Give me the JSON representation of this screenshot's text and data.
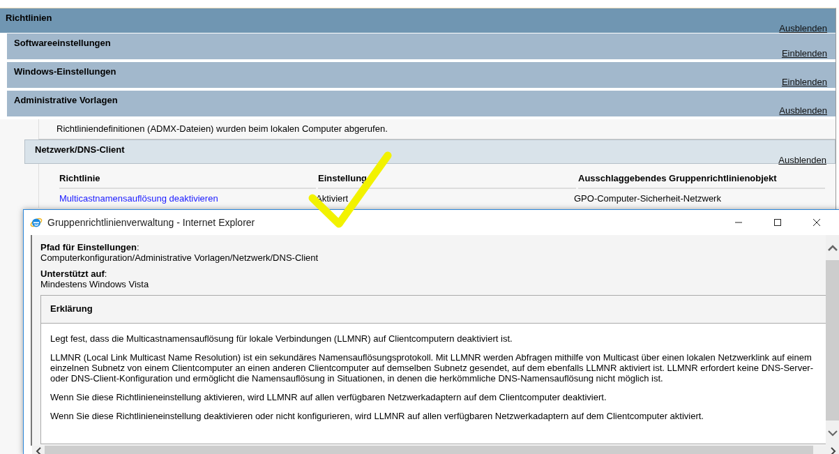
{
  "report": {
    "title": "Richtlinien",
    "toggle": "Ausblenden",
    "children": [
      {
        "title": "Softwareeinstellungen",
        "toggle": "Einblenden"
      },
      {
        "title": "Windows-Einstellungen",
        "toggle": "Einblenden"
      },
      {
        "title": "Administrative Vorlagen",
        "toggle": "Ausblenden",
        "note": "Richtliniendefinitionen (ADMX-Dateien) wurden beim lokalen Computer abgerufen.",
        "children": [
          {
            "title": "Netzwerk/DNS-Client",
            "toggle": "Ausblenden",
            "table": {
              "columns": [
                "Richtlinie",
                "Einstellung",
                "Ausschlaggebendes Gruppenrichtlinienobjekt"
              ],
              "rows": [
                {
                  "cells": [
                    "Multicastnamensauflösung deaktivieren",
                    "Aktiviert",
                    "GPO-Computer-Sicherheit-Netzwerk"
                  ]
                }
              ]
            }
          }
        ]
      }
    ]
  },
  "popup": {
    "title": "Gruppenrichtlinienverwaltung - Internet Explorer",
    "fields": [
      {
        "label": "**Pfad für Einstellungen**:",
        "value": "Computerkonfiguration/Administrative Vorlagen/Netzwerk/DNS-Client"
      },
      {
        "label": "**Unterstützt auf**:",
        "value": "Mindestens Windows Vista"
      }
    ],
    "explanation": {
      "heading": "Erklärung",
      "paragraphs": [
        "Legt fest, dass die Multicastnamensauflösung für lokale Verbindungen (LLMNR) auf Clientcomputern deaktiviert ist.",
        "LLMNR (Local Link Multicast Name Resolution) ist ein sekundäres Namensauflösungsprotokoll. Mit LLMNR werden Abfragen mithilfe von Multicast über einen lokalen Netzwerklink auf einem einzelnen Subnetz von einem Clientcomputer an einen anderen Clientcomputer auf demselben Subnetz gesendet, auf dem ebenfalls LLMNR aktiviert ist. LLMNR erfordert keine DNS-Server- oder DNS-Client-Konfiguration und ermöglicht die Namensauflösung in Situationen, in denen die herkömmliche DNS-Namensauflösung nicht möglich ist.",
        "Wenn Sie diese Richtlinieneinstellung aktivieren, wird LLMNR auf allen verfügbaren Netzwerkadaptern auf dem Clientcomputer deaktiviert.",
        "Wenn Sie diese Richtlinieneinstellung deaktivieren oder nicht konfigurieren, wird LLMNR auf allen verfügbaren Netzwerkadaptern auf dem Clientcomputer aktiviert."
      ]
    }
  }
}
